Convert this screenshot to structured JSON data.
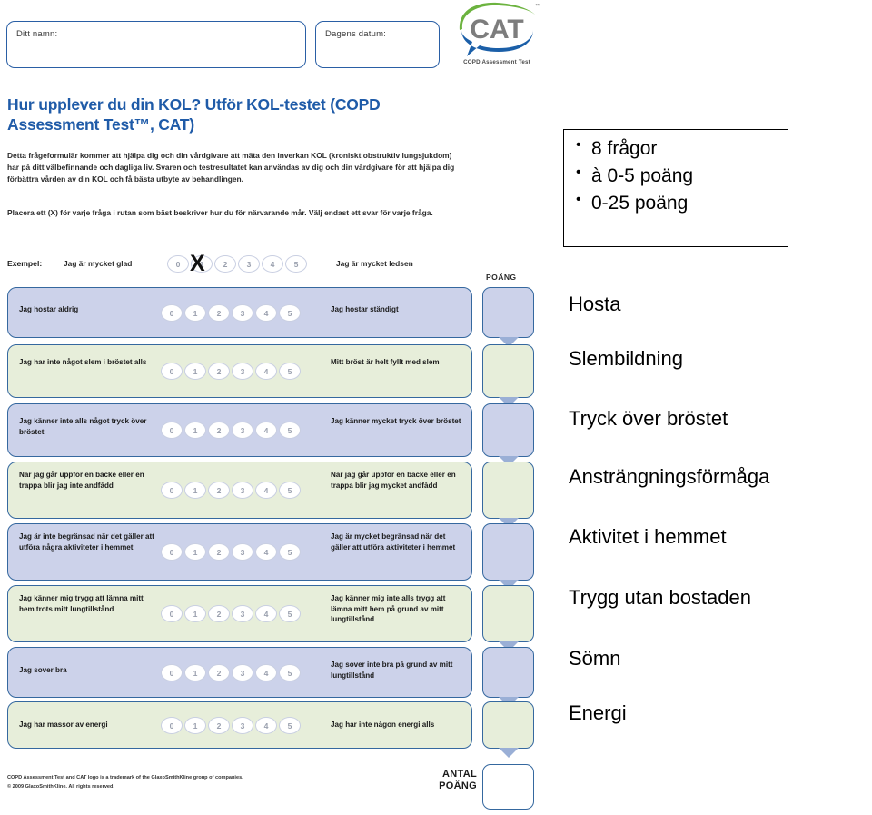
{
  "form": {
    "name_field_label": "Ditt namn:",
    "date_field_label": "Dagens datum:",
    "logo": {
      "text": "CAT",
      "tm": "™",
      "subtitle": "COPD Assessment Test",
      "green": "#6cb33f",
      "blue": "#1b5fa8",
      "gray": "#7d7d7d"
    },
    "title": "Hur upplever du din KOL? Utför KOL-testet (COPD Assessment Test™, CAT)",
    "intro_1": "Detta frågeformulär kommer att hjälpa dig och din vårdgivare att mäta den inverkan KOL (kroniskt obstruktiv lungsjukdom) har på ditt välbefinnande och dagliga liv. Svaren och testresultatet kan användas av dig och din vårdgivare för att hjälpa dig förbättra vården av din KOL och få bästa utbyte av behandlingen.",
    "intro_2": "Placera ett (X) för varje fråga i rutan som bäst beskriver hur du för närvarande mår. Välj endast ett svar för varje fråga.",
    "example": {
      "label": "Exempel:",
      "left": "Jag är mycket glad",
      "right": "Jag är mycket ledsen",
      "marked_value": "1",
      "mark": "X"
    },
    "scale_options": [
      "0",
      "1",
      "2",
      "3",
      "4",
      "5"
    ],
    "score_column_header": "POÄNG",
    "total_label": "ANTAL\nPOÄNG",
    "total_label_line1": "ANTAL",
    "total_label_line2": "POÄNG",
    "copyright_line1": "COPD Assessment Test and CAT logo is a trademark of the GlaxoSmithKline group of companies.",
    "copyright_line2": "© 2009 GlaxoSmithKline. All rights reserved.",
    "colors": {
      "row_blue": "#ccd2ea",
      "row_green": "#e7eeda",
      "row_border": "#35689f",
      "title_blue": "#1f5ba8",
      "arrow": "#9aafd6"
    },
    "questions": [
      {
        "left": "Jag hostar aldrig",
        "right": "Jag hostar ständigt",
        "tone": "blue"
      },
      {
        "left": "Jag har inte något slem i bröstet alls",
        "right": "Mitt bröst är helt fyllt med slem",
        "tone": "green"
      },
      {
        "left": "Jag känner inte alls något tryck över bröstet",
        "right": "Jag känner mycket tryck över bröstet",
        "tone": "blue"
      },
      {
        "left": "När jag går uppför en backe eller en trappa blir jag inte andfådd",
        "right": "När jag går uppför en backe eller en trappa blir jag mycket andfådd",
        "tone": "green"
      },
      {
        "left": "Jag är inte begränsad när det gäller att utföra några aktiviteter i hemmet",
        "right": "Jag är mycket begränsad när det gäller att utföra aktiviteter i hemmet",
        "tone": "blue"
      },
      {
        "left": "Jag känner mig trygg att lämna mitt hem trots mitt lungtillstånd",
        "right": "Jag känner mig inte alls trygg att lämna mitt hem på grund av mitt lungtillstånd",
        "tone": "green"
      },
      {
        "left": "Jag sover bra",
        "right": "Jag sover inte bra på grund av mitt lungtillstånd",
        "tone": "blue"
      },
      {
        "left": "Jag har massor av energi",
        "right": "Jag har inte någon energi alls",
        "tone": "green"
      }
    ]
  },
  "annotations": {
    "summary_bullets": [
      "8 frågor",
      "à 0-5 poäng",
      "0-25 poäng"
    ],
    "domain_labels": [
      "Hosta",
      "Slembildning",
      "Tryck över bröstet",
      "Ansträngningsförmåga",
      "Aktivitet i hemmet",
      "Trygg utan bostaden",
      "Sömn",
      "Energi"
    ]
  }
}
